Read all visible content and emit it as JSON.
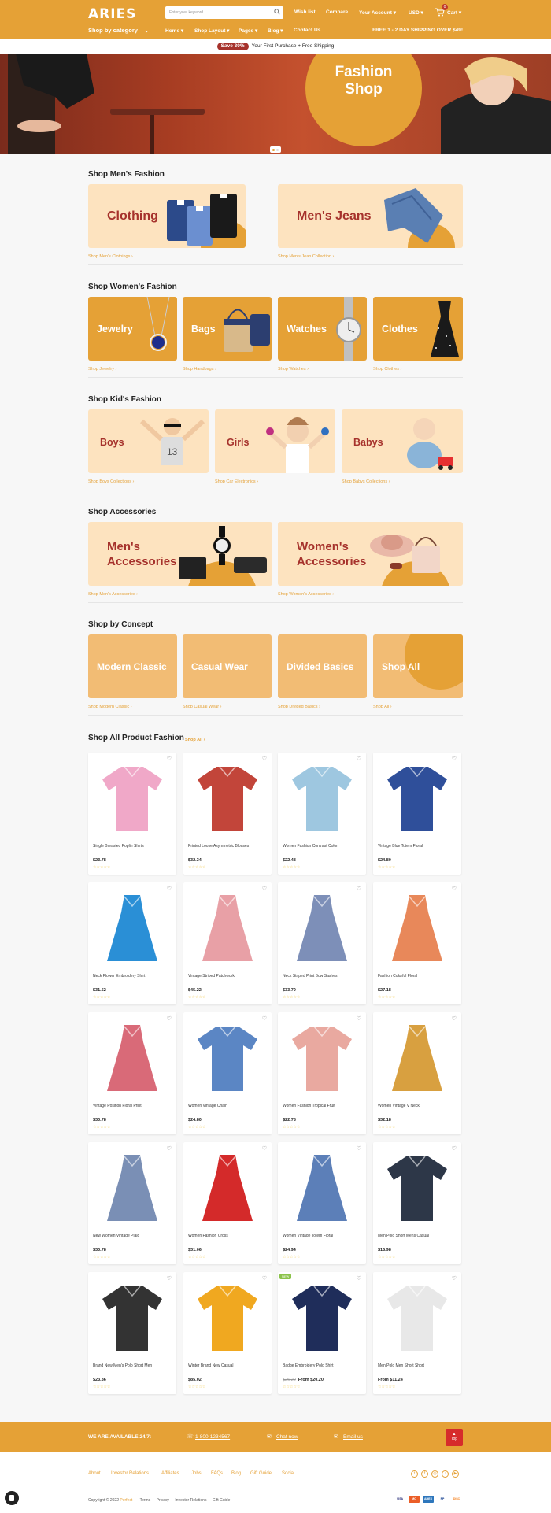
{
  "header": {
    "logo": "ARIES",
    "search_placeholder": "Enter your keyword ...",
    "wishlist": "Wish list",
    "compare": "Compare",
    "account": "Your Account",
    "currency": "USD",
    "cart": "Cart",
    "cart_count": "0",
    "shop_by_category": "Shop by category",
    "nav": [
      "Home",
      "Shop Layout",
      "Pages",
      "Blog",
      "Contact Us"
    ],
    "free_shipping": "FREE 1 - 2 DAY SHIPPING OVER $49!"
  },
  "promo": {
    "badge": "Save 30%",
    "text": "Your First Purchase + Free Shipping"
  },
  "hero": {
    "title_line1": "Fashion",
    "title_line2": "Shop"
  },
  "mens": {
    "title": "Shop Men's Fashion",
    "cards": [
      {
        "label": "Clothing",
        "link": "Shop Men's Clothings"
      },
      {
        "label": "Men's Jeans",
        "link": "Shop Men's Jean Collection"
      }
    ]
  },
  "womens": {
    "title": "Shop Women's Fashion",
    "cards": [
      {
        "label": "Jewelry",
        "link": "Shop Jewelry"
      },
      {
        "label": "Bags",
        "link": "Shop Handbags"
      },
      {
        "label": "Watches",
        "link": "Shop Watches"
      },
      {
        "label": "Clothes",
        "link": "Shop Clothes"
      }
    ]
  },
  "kids": {
    "title": "Shop Kid's Fashion",
    "cards": [
      {
        "label": "Boys",
        "link": "Shop Boys Collections"
      },
      {
        "label": "Girls",
        "link": "Shop Car Electronics"
      },
      {
        "label": "Babys",
        "link": "Shop Babys Collections"
      }
    ]
  },
  "accessories": {
    "title": "Shop Accessories",
    "cards": [
      {
        "label1": "Men's",
        "label2": "Accessories",
        "link": "Shop Men's Accessories"
      },
      {
        "label1": "Women's",
        "label2": "Accessories",
        "link": "Shop Women's Accessories"
      }
    ]
  },
  "concept": {
    "title": "Shop by Concept",
    "cards": [
      {
        "label": "Modern Classic",
        "link": "Shop Modern Classic"
      },
      {
        "label": "Casual Wear",
        "link": "Shop Casual Wear"
      },
      {
        "label": "Divided Basics",
        "link": "Shop Divided Basics"
      },
      {
        "label": "Shop All",
        "link": "Shop All"
      }
    ]
  },
  "products": {
    "title": "Shop All Product Fashion",
    "shop_all": "Shop All",
    "stars": "☆☆☆☆☆",
    "items": [
      {
        "name": "Single Breasted Poplin Shirts",
        "price": "$23.78",
        "color": "#f0a8c8"
      },
      {
        "name": "Printed Loose Asymmetric Blouses",
        "price": "$32.34",
        "color": "#c2453a"
      },
      {
        "name": "Women Fashion Contrast Color",
        "price": "$22.48",
        "color": "#9ec7e0"
      },
      {
        "name": "Vintage Blue Totem Floral",
        "price": "$24.80",
        "color": "#2f4f9a"
      },
      {
        "name": "Neck Flower Embroidery Shirt",
        "price": "$31.52",
        "color": "#2a8fd6"
      },
      {
        "name": "Vintage Striped Patchwork",
        "price": "$45.22",
        "color": "#e8a0a6"
      },
      {
        "name": "Neck Striped Print Bow Sashes",
        "price": "$33.70",
        "color": "#7d8fb8"
      },
      {
        "name": "Fashion Colorful Floral",
        "price": "$27.18",
        "color": "#e8885a"
      },
      {
        "name": "Vintage Position Floral Print",
        "price": "$30.78",
        "color": "#d96a78"
      },
      {
        "name": "Women Vintage Chain",
        "price": "$24.80",
        "color": "#5b86c4"
      },
      {
        "name": "Women Fashion Tropical Fruit",
        "price": "$22.78",
        "color": "#e9a9a0"
      },
      {
        "name": "Women Vintage V Neck",
        "price": "$32.18",
        "color": "#d8a040"
      },
      {
        "name": "New Women Vintage Plaid",
        "price": "$30.78",
        "color": "#7a8fb5"
      },
      {
        "name": "Women Fashion Cross",
        "price": "$31.06",
        "color": "#d42a2a"
      },
      {
        "name": "Women Vintage Totem Floral",
        "price": "$24.94",
        "color": "#5c7fb8"
      },
      {
        "name": "Men Polo Short Mens Casual",
        "price": "$15.98",
        "color": "#2d3748"
      },
      {
        "name": "Brand New Men's Polo Short Men",
        "price": "$23.36",
        "color": "#333333"
      },
      {
        "name": "Winter Brand New Casual",
        "price": "$85.02",
        "color": "#f0a820"
      },
      {
        "name": "Badge Embroidery Polo Shirt",
        "price": "From $20.20",
        "old_price": "$26.20",
        "badge": "NEW",
        "color": "#1f2d5a"
      },
      {
        "name": "Men Polo Men Short Short",
        "price": "From $11.24",
        "color": "#e8e8e8"
      }
    ]
  },
  "footer": {
    "available": "WE ARE AVAILABLE 24/7:",
    "phone": "1-800-1234567",
    "chat": "Chat now",
    "email": "Email us",
    "top": "Top",
    "links": [
      "About",
      "Investor Relations",
      "Affiliates",
      "Jobs",
      "FAQs",
      "Blog",
      "Gift Guide",
      "Social"
    ],
    "copyright": "Copyright © 2022",
    "brand": "Perfect",
    "bottom_links": [
      "Terms",
      "Privacy",
      "Investor Relations",
      "Gift Guide"
    ],
    "payments": [
      "VISA",
      "MC",
      "AMEX",
      "PP",
      "DISC"
    ]
  },
  "colors": {
    "accent": "#e5a136",
    "light": "#fde3bf",
    "dark_red": "#a6322c"
  }
}
